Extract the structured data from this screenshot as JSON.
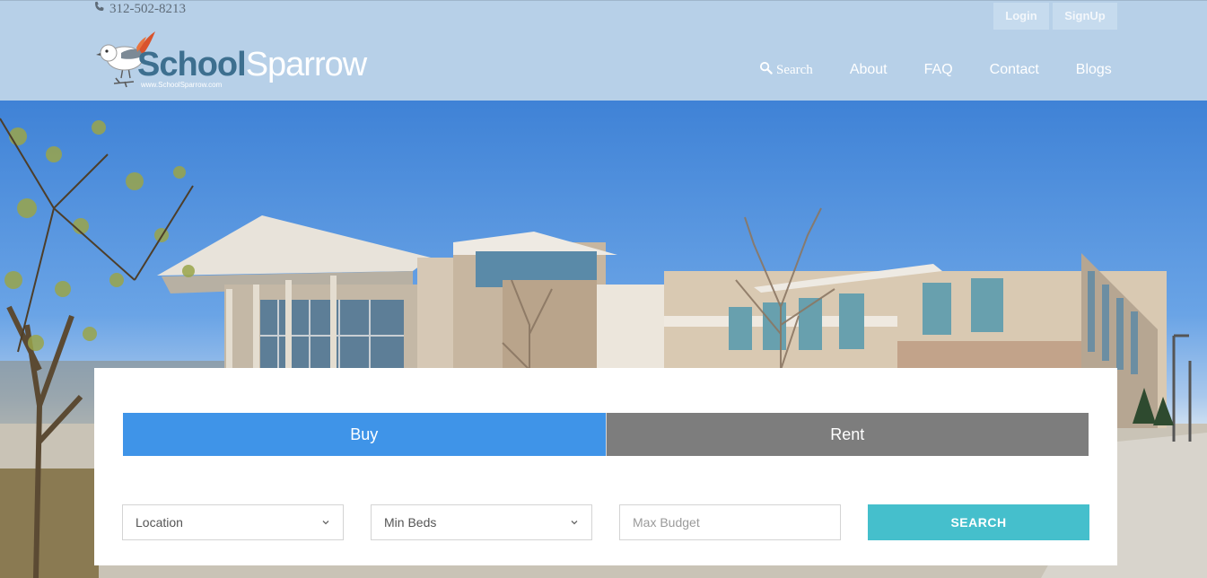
{
  "header": {
    "phone": "312-502-8213",
    "login_label": "Login",
    "signup_label": "SignUp",
    "logo": {
      "part1": "School",
      "part2": "Sparrow",
      "url": "www.SchoolSparrow.com"
    },
    "nav": [
      {
        "label": "Search"
      },
      {
        "label": "About"
      },
      {
        "label": "FAQ"
      },
      {
        "label": "Contact"
      },
      {
        "label": "Blogs"
      }
    ]
  },
  "search_panel": {
    "tabs": [
      {
        "label": "Buy",
        "active": true
      },
      {
        "label": "Rent",
        "active": false
      }
    ],
    "location_select": {
      "value": "Location"
    },
    "beds_select": {
      "value": "Min Beds"
    },
    "budget_input": {
      "placeholder": "Max Budget",
      "value": ""
    },
    "search_button": "SEARCH"
  },
  "colors": {
    "header_bg": "#b7d0e8",
    "tab_active": "#3f94e8",
    "tab_inactive": "#7d7d7d",
    "search_button": "#45bfcc"
  },
  "icons": {
    "phone": "phone-icon",
    "search": "search-icon",
    "chevron": "chevron-down-icon"
  }
}
